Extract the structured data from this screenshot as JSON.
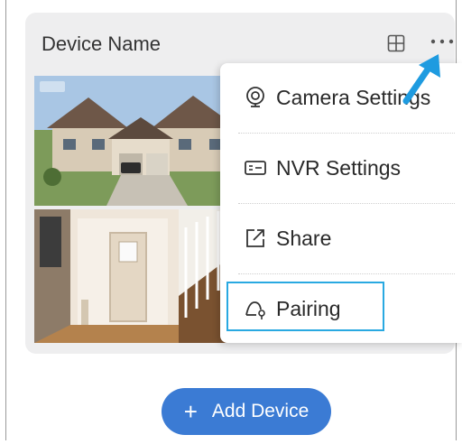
{
  "device": {
    "name": "Device Name"
  },
  "menu": {
    "items": [
      {
        "label": "Camera Settings",
        "icon": "camera-icon"
      },
      {
        "label": "NVR Settings",
        "icon": "nvr-icon"
      },
      {
        "label": "Share",
        "icon": "share-icon"
      },
      {
        "label": "Pairing",
        "icon": "pairing-icon"
      }
    ],
    "highlighted": "Pairing"
  },
  "actions": {
    "add_device_label": "Add Device",
    "add_icon": "plus-icon"
  },
  "colors": {
    "accent": "#3b7bd4",
    "highlight": "#29a9e1",
    "card_bg": "#eeeeef"
  }
}
